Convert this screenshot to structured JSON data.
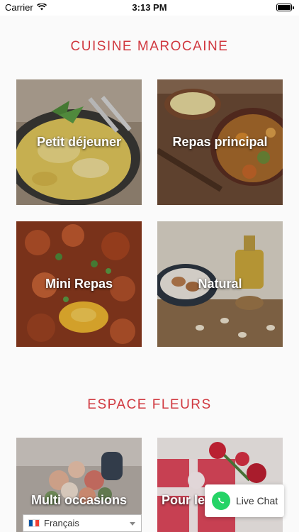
{
  "status_bar": {
    "carrier": "Carrier",
    "time": "3:13 PM",
    "battery_level": 1.0
  },
  "sections": [
    {
      "title": "CUISINE MAROCAINE",
      "tiles": [
        {
          "label": "Petit déjeuner"
        },
        {
          "label": "Repas principal"
        },
        {
          "label": "Mini Repas"
        },
        {
          "label": "Natural"
        }
      ]
    },
    {
      "title": "ESPACE FLEURS",
      "tiles": [
        {
          "label": "Multi occasions"
        },
        {
          "label": "Pour le"
        }
      ]
    }
  ],
  "language_select": {
    "selected": "Français",
    "flag": "france-flag-icon"
  },
  "live_chat": {
    "label": "Live Chat",
    "icon": "whatsapp-icon",
    "color": "#25d366"
  },
  "colors": {
    "accent": "#d0383f",
    "background": "#fafafa"
  }
}
